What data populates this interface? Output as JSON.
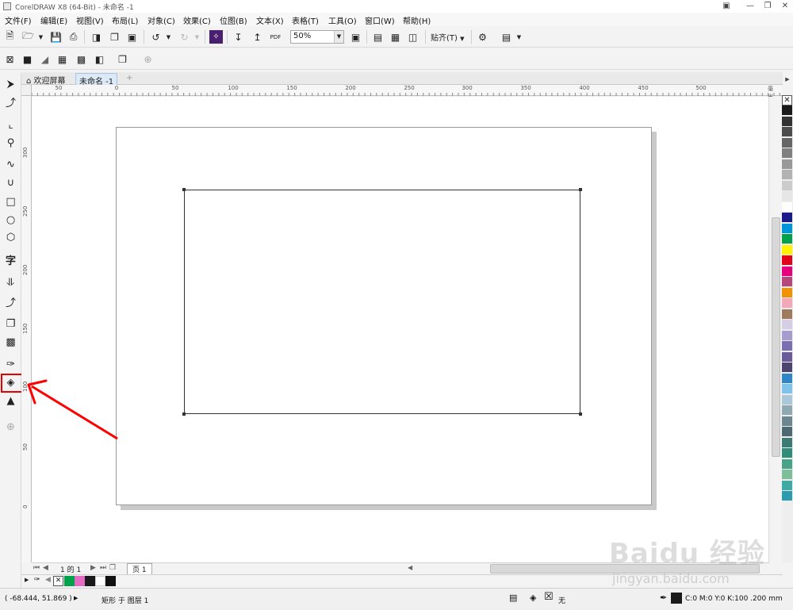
{
  "window": {
    "title": "CorelDRAW X8 (64-Bit) - 未命名 -1"
  },
  "menubar": {
    "items": [
      "文件(F)",
      "编辑(E)",
      "视图(V)",
      "布局(L)",
      "对象(C)",
      "效果(C)",
      "位图(B)",
      "文本(X)",
      "表格(T)",
      "工具(O)",
      "窗口(W)",
      "帮助(H)"
    ]
  },
  "toolbar": {
    "zoom_value": "50%",
    "snap_label": "贴齐(T)",
    "pdf_label": "PDF"
  },
  "doctabs": {
    "welcome_label": "欢迎屏幕",
    "document_label": "未命名 -1",
    "add_label": "+"
  },
  "rulers": {
    "horizontal_ticks": [
      "50",
      "0",
      "50",
      "100",
      "150",
      "200",
      "250",
      "300",
      "350",
      "400",
      "450",
      "500"
    ],
    "horizontal_unit": "毫米",
    "vertical_ticks": [
      "300",
      "250",
      "200",
      "150",
      "100",
      "50",
      "0"
    ]
  },
  "toolbox": {
    "text_tool_glyph": "字"
  },
  "palette": {
    "colors": [
      "#1a1a1a",
      "#333333",
      "#4d4d4d",
      "#666666",
      "#808080",
      "#999999",
      "#b3b3b3",
      "#cccccc",
      "#e6e6e6",
      "#ffffff",
      "#1b1b8c",
      "#0094d9",
      "#00a14b",
      "#fff100",
      "#e3001b",
      "#e6007e",
      "#b6467b",
      "#f39200",
      "#f4a7b9",
      "#9e7b5e",
      "#d6cde6",
      "#a79cd0",
      "#7a6fb0",
      "#6b5a9a",
      "#4e4470",
      "#2d86c8",
      "#7fc3ea",
      "#a9c7d6",
      "#8fa9b3",
      "#6d8790",
      "#4d6a72",
      "#3d7a74",
      "#2f8d7a",
      "#4aa389",
      "#7dbf9a",
      "#3fa9a4",
      "#2b9bb0"
    ]
  },
  "pagenav": {
    "page_label": "1 的 1",
    "page_tab": "页 1"
  },
  "statusbar": {
    "coordinates": "( -68.444, 51.869 )",
    "object_info": "矩形 于 图层 1",
    "fill_none": "无",
    "outline_info": "C:0 M:0 Y:0 K:100 .200 mm"
  },
  "watermark": {
    "brand": "Baidu 经验",
    "url": "jingyan.baidu.com"
  }
}
